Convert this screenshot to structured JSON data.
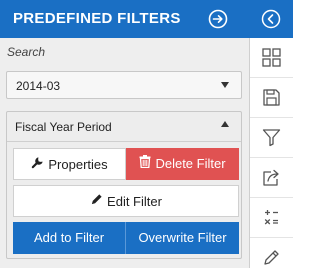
{
  "panel": {
    "title": "PREDEFINED FILTERS",
    "search_label": "Search",
    "date_value": "2014-03",
    "filter_group": {
      "label": "Fiscal Year Period",
      "buttons": {
        "properties": "Properties",
        "delete": "Delete Filter",
        "edit": "Edit Filter",
        "add": "Add to Filter",
        "overwrite": "Overwrite Filter"
      }
    }
  },
  "rail": {
    "icons": [
      "collapse-left-icon",
      "grid-icon",
      "save-icon",
      "filter-icon",
      "export-icon",
      "calculator-icon",
      "pencil-icon"
    ]
  },
  "colors": {
    "accent": "#1a6fc4",
    "danger": "#e05252",
    "panel_bg": "#eeeeee"
  }
}
